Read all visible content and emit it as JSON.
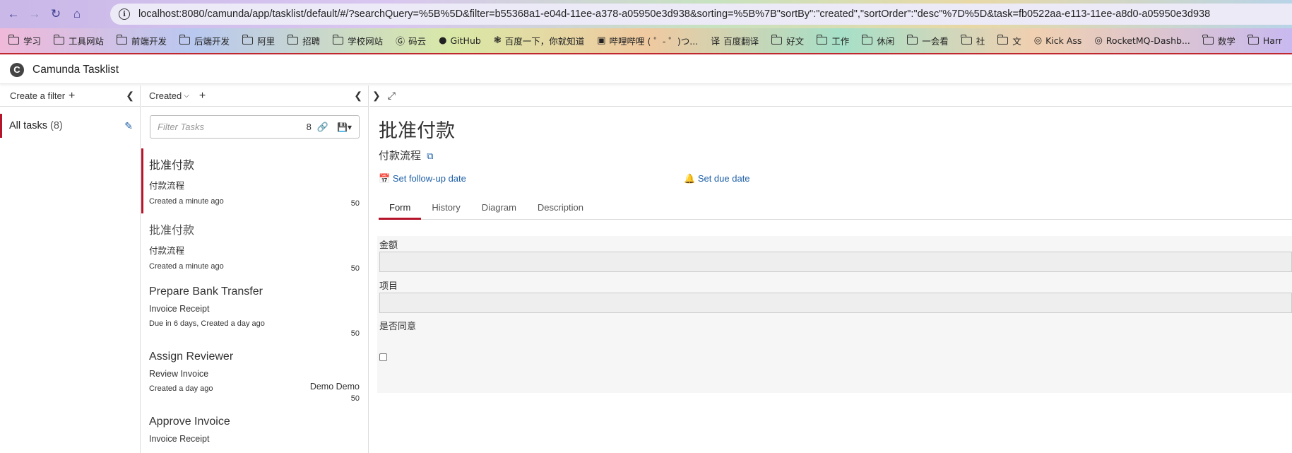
{
  "browser": {
    "url": "localhost:8080/camunda/app/tasklist/default/#/?searchQuery=%5B%5D&filter=b55368a1-e04d-11ee-a378-a05950e3d938&sorting=%5B%7B\"sortBy\":\"created\",\"sortOrder\":\"desc\"%7D%5D&task=fb0522aa-e113-11ee-a8d0-a05950e3d938",
    "bookmarks": [
      {
        "label": "学习",
        "icon": "folder-icon"
      },
      {
        "label": "工具网站",
        "icon": "folder-icon"
      },
      {
        "label": "前端开发",
        "icon": "folder-icon"
      },
      {
        "label": "后端开发",
        "icon": "folder-icon"
      },
      {
        "label": "阿里",
        "icon": "folder-icon"
      },
      {
        "label": "招聘",
        "icon": "folder-icon"
      },
      {
        "label": "学校网站",
        "icon": "folder-icon"
      },
      {
        "label": "码云",
        "icon": "gitee-icon"
      },
      {
        "label": "GitHub",
        "icon": "github-icon"
      },
      {
        "label": "百度一下，你就知道",
        "icon": "baidu-icon"
      },
      {
        "label": "哔哩哔哩 ( ゜- ゜)つ...",
        "icon": "bilibili-icon"
      },
      {
        "label": "百度翻译",
        "icon": "translate-icon"
      },
      {
        "label": "好文",
        "icon": "folder-icon"
      },
      {
        "label": "工作",
        "icon": "folder-icon"
      },
      {
        "label": "休闲",
        "icon": "folder-icon"
      },
      {
        "label": "一会看",
        "icon": "folder-icon"
      },
      {
        "label": "社",
        "icon": "folder-icon"
      },
      {
        "label": "文",
        "icon": "folder-icon"
      },
      {
        "label": "Kick Ass",
        "icon": "globe-icon"
      },
      {
        "label": "RocketMQ-Dashb...",
        "icon": "globe-icon"
      },
      {
        "label": "数学",
        "icon": "folder-icon"
      },
      {
        "label": "Harr",
        "icon": "folder-icon"
      }
    ]
  },
  "app": {
    "title": "Camunda Tasklist",
    "logo_letter": "C"
  },
  "filters": {
    "create_label": "Create a filter",
    "items": [
      {
        "label": "All tasks",
        "count": "(8)"
      }
    ]
  },
  "tasklist": {
    "sort_label": "Created",
    "search_placeholder": "Filter Tasks",
    "search_count": "8",
    "tasks": [
      {
        "name": "批准付款",
        "process": "付款流程",
        "assignee": "",
        "meta": "Created a minute ago",
        "priority": "50"
      },
      {
        "name": "批准付款",
        "process": "付款流程",
        "assignee": "",
        "meta": "Created a minute ago",
        "priority": "50"
      },
      {
        "name": "Prepare Bank Transfer",
        "process": "Invoice Receipt",
        "assignee": "",
        "meta": "Due in 6 days, Created a day ago",
        "priority": "50"
      },
      {
        "name": "Assign Reviewer",
        "process": "Review Invoice",
        "assignee": "Demo Demo",
        "meta": "Created a day ago",
        "priority": "50"
      },
      {
        "name": "Approve Invoice",
        "process": "Invoice Receipt",
        "assignee": "",
        "meta": "",
        "priority": ""
      }
    ]
  },
  "detail": {
    "title": "批准付款",
    "process": "付款流程",
    "follow_up_label": "Set follow-up date",
    "due_label": "Set due date",
    "tabs": [
      "Form",
      "History",
      "Diagram",
      "Description"
    ],
    "active_tab": "Form",
    "form": {
      "fields": [
        {
          "label": "金额",
          "value": ""
        },
        {
          "label": "项目",
          "value": ""
        },
        {
          "label": "是否同意",
          "checked": false
        }
      ]
    }
  },
  "colors": {
    "accent": "#b5152b",
    "link": "#1d5fa8"
  }
}
